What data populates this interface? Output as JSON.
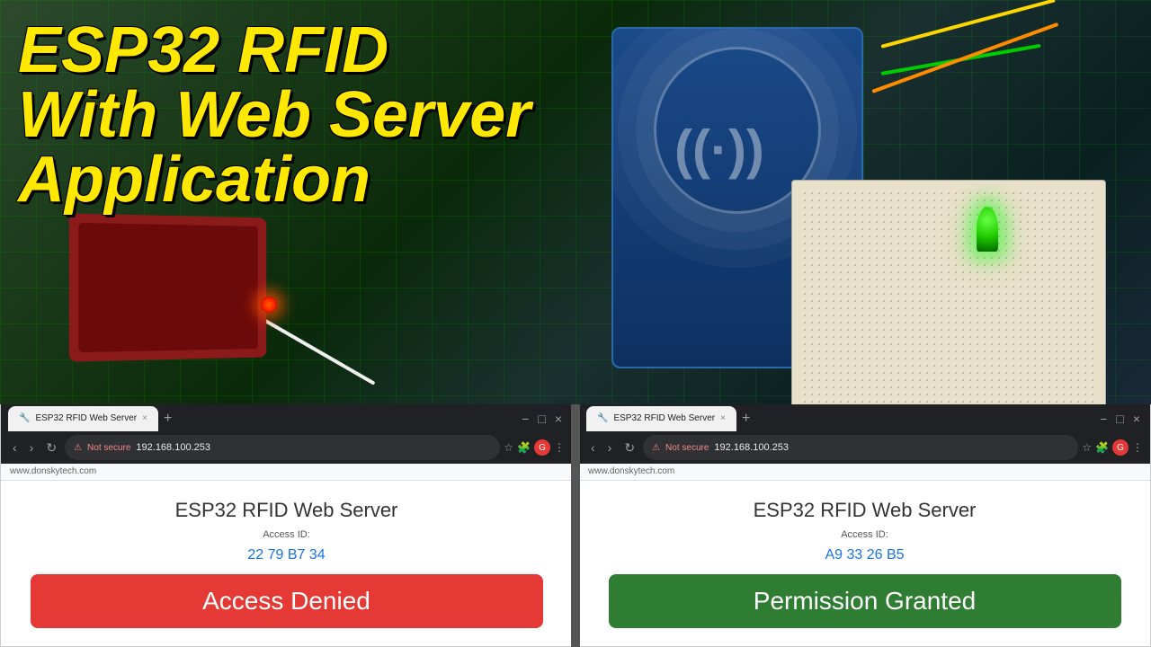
{
  "title": "ESP32 RFID With Web Server Application",
  "title_line1": "ESP32 RFID",
  "title_line2": "With Web Server",
  "title_line3": "Application",
  "browser_left": {
    "tab_label": "ESP32 RFID Web Server",
    "url": "192.168.100.253",
    "website_label": "www.donskytech.com",
    "page_title": "ESP32 RFID Web Server",
    "access_id_label": "Access ID:",
    "access_id": "22 79 B7 34",
    "button_label": "Access Denied",
    "button_color": "#e53935"
  },
  "browser_right": {
    "tab_label": "ESP32 RFID Web Server",
    "url": "192.168.100.253",
    "website_label": "www.donskytech.com",
    "page_title": "ESP32 RFID Web Server",
    "access_id_label": "Access ID:",
    "access_id": "A9 33 26 B5",
    "button_label": "Permission Granted",
    "button_color": "#2e7d32"
  },
  "nav": {
    "back": "‹",
    "forward": "›",
    "reload": "↻",
    "not_secure": "Not secure",
    "minimize": "−",
    "maximize": "□",
    "close": "×"
  }
}
